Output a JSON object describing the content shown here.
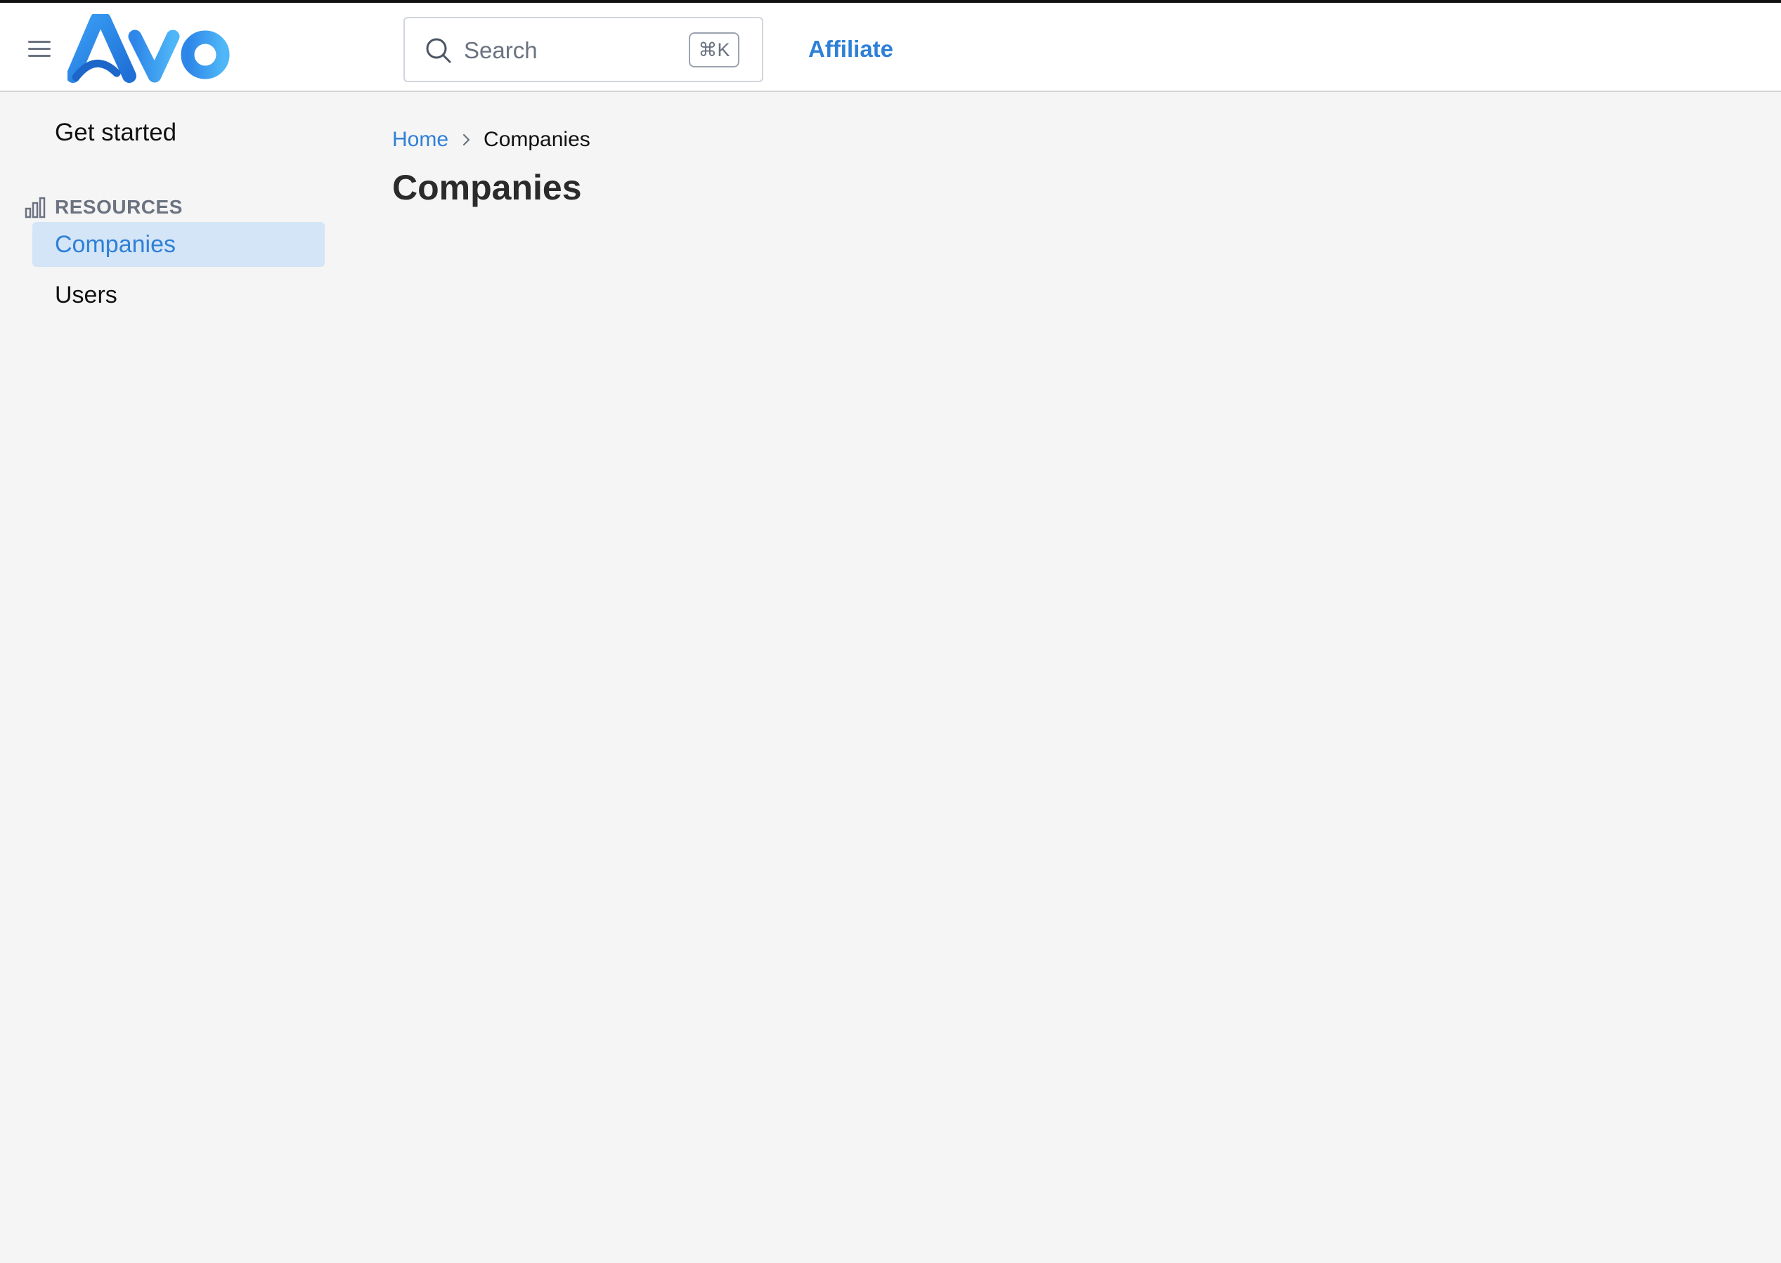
{
  "header": {
    "logo_text": "AVO",
    "search": {
      "placeholder": "Search",
      "shortcut": "⌘K"
    },
    "affiliate_label": "Affiliate"
  },
  "sidebar": {
    "get_started_label": "Get started",
    "section_label": "RESOURCES",
    "items": [
      {
        "label": "Companies",
        "active": true
      },
      {
        "label": "Users",
        "active": false
      }
    ]
  },
  "main": {
    "breadcrumb": {
      "home": "Home",
      "current": "Companies"
    },
    "title": "Companies"
  },
  "colors": {
    "accent": "#2f80d7",
    "active_bg": "#d3e5f7",
    "page_bg": "#f5f5f5",
    "muted": "#6b7280"
  },
  "icons": [
    "menu-icon",
    "search-icon",
    "bar-chart-icon",
    "chevron-right-icon"
  ]
}
